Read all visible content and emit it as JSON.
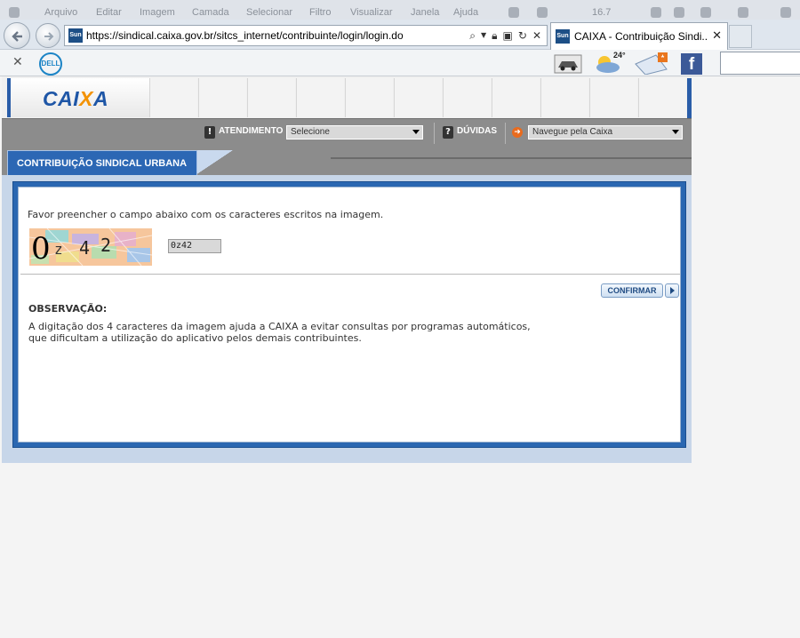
{
  "browser": {
    "menu_items": [
      "Arquivo",
      "Editar",
      "Imagem",
      "Camada",
      "Selecionar",
      "Filtro",
      "Visualizar",
      "Janela",
      "Ajuda"
    ],
    "zoom": "16.7",
    "url": "https://sindical.caixa.gov.br/sitcs_internet/contribuinte/login/login.do",
    "tab_title": "CAIXA - Contribuição Sindi...",
    "favicon_text": "Sun",
    "weather_temp": "24°",
    "dell_label": "DELL",
    "facebook_label": "f"
  },
  "site": {
    "logo_prefix": "CAI",
    "logo_x": "X",
    "logo_suffix": "A",
    "toolbar": {
      "atendimento_label": "ATENDIMENTO",
      "atendimento_select": "Selecione",
      "duvidas_label": "DÚVIDAS",
      "navegue_select": "Navegue pela Caixa"
    },
    "section_tab": "CONTRIBUIÇÃO SINDICAL URBANA"
  },
  "form": {
    "instruction": "Favor preencher o campo abaixo com os caracteres escritos na imagem.",
    "captcha_chars": [
      "0",
      "z",
      "4",
      "2"
    ],
    "captcha_value": "0z42",
    "confirm_label": "CONFIRMAR",
    "obs_title": "OBSERVAÇÃO:",
    "obs_line1": "A digitação dos 4 caracteres da imagem ajuda a CAIXA a evitar consultas por programas automáticos,",
    "obs_line2": "que dificultam a utilização do aplicativo pelos demais contribuintes."
  },
  "colors": {
    "brand_blue": "#2a67b1",
    "brand_orange": "#f39200",
    "toolbar_gray": "#8c8c8c"
  }
}
